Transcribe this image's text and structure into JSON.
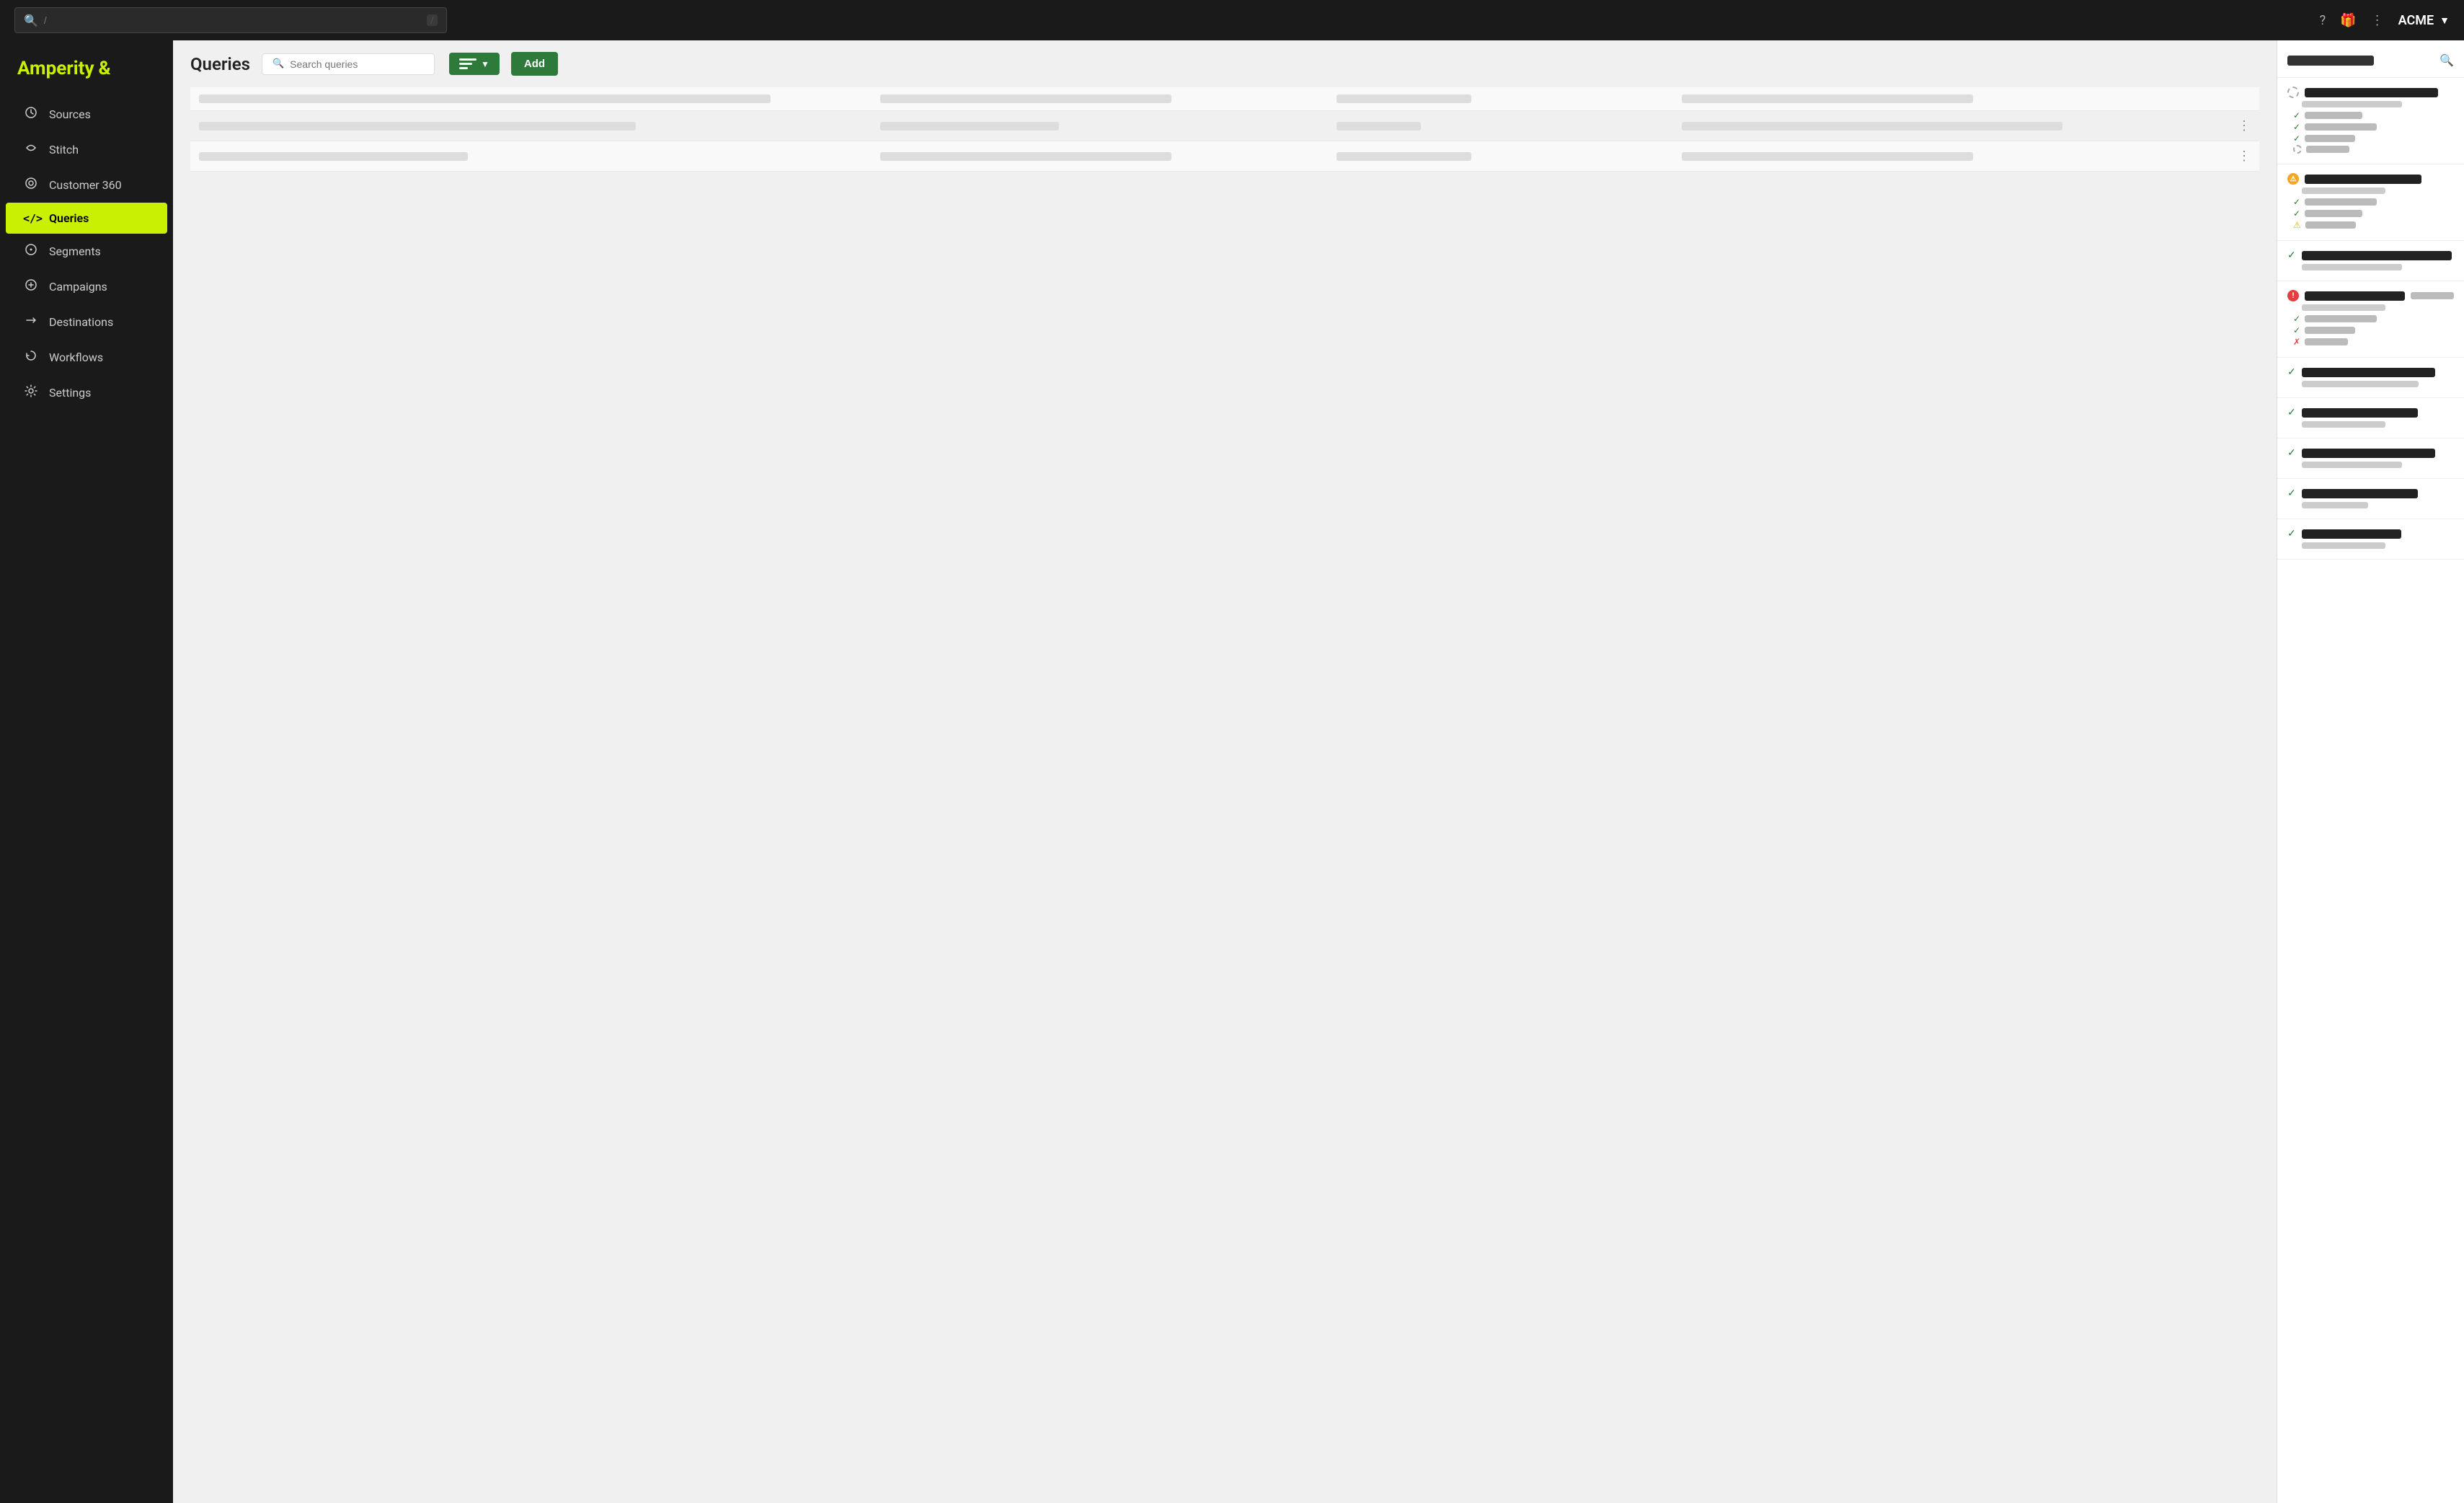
{
  "app": {
    "name": "Amperity",
    "account": "ACME"
  },
  "topbar": {
    "search_placeholder": "/",
    "help_icon": "?",
    "gift_icon": "🎁",
    "more_icon": "⋮"
  },
  "sidebar": {
    "items": [
      {
        "id": "sources",
        "label": "Sources",
        "icon": "⟳"
      },
      {
        "id": "stitch",
        "label": "Stitch",
        "icon": "✦"
      },
      {
        "id": "customer360",
        "label": "Customer 360",
        "icon": "⊙"
      },
      {
        "id": "queries",
        "label": "Queries",
        "icon": "</>"
      },
      {
        "id": "segments",
        "label": "Segments",
        "icon": "◎"
      },
      {
        "id": "campaigns",
        "label": "Campaigns",
        "icon": "⊕"
      },
      {
        "id": "destinations",
        "label": "Destinations",
        "icon": "→"
      },
      {
        "id": "workflows",
        "label": "Workflows",
        "icon": "⟲"
      },
      {
        "id": "settings",
        "label": "Settings",
        "icon": "⚙"
      }
    ],
    "active": "queries"
  },
  "queries": {
    "title": "Queries",
    "search_placeholder": "Search queries",
    "add_label": "Add",
    "rows": [
      {
        "id": 1
      },
      {
        "id": 2,
        "has_menu": true
      },
      {
        "id": 3,
        "has_menu": true
      }
    ]
  },
  "right_panel": {
    "search_icon": "🔍",
    "items": [
      {
        "status": "loading",
        "sub_items": [
          {
            "type": "check"
          },
          {
            "type": "check"
          },
          {
            "type": "check"
          },
          {
            "type": "loading"
          }
        ]
      },
      {
        "status": "warning",
        "sub_items": [
          {
            "type": "check"
          },
          {
            "type": "check"
          },
          {
            "type": "warning"
          }
        ]
      },
      {
        "status": "check",
        "sub_items": []
      },
      {
        "status": "error",
        "sub_items": [
          {
            "type": "check"
          },
          {
            "type": "check"
          },
          {
            "type": "error"
          }
        ]
      },
      {
        "status": "check",
        "sub_items": []
      },
      {
        "status": "check",
        "sub_items": []
      },
      {
        "status": "check",
        "sub_items": []
      },
      {
        "status": "check",
        "sub_items": []
      },
      {
        "status": "check",
        "sub_items": []
      }
    ]
  }
}
